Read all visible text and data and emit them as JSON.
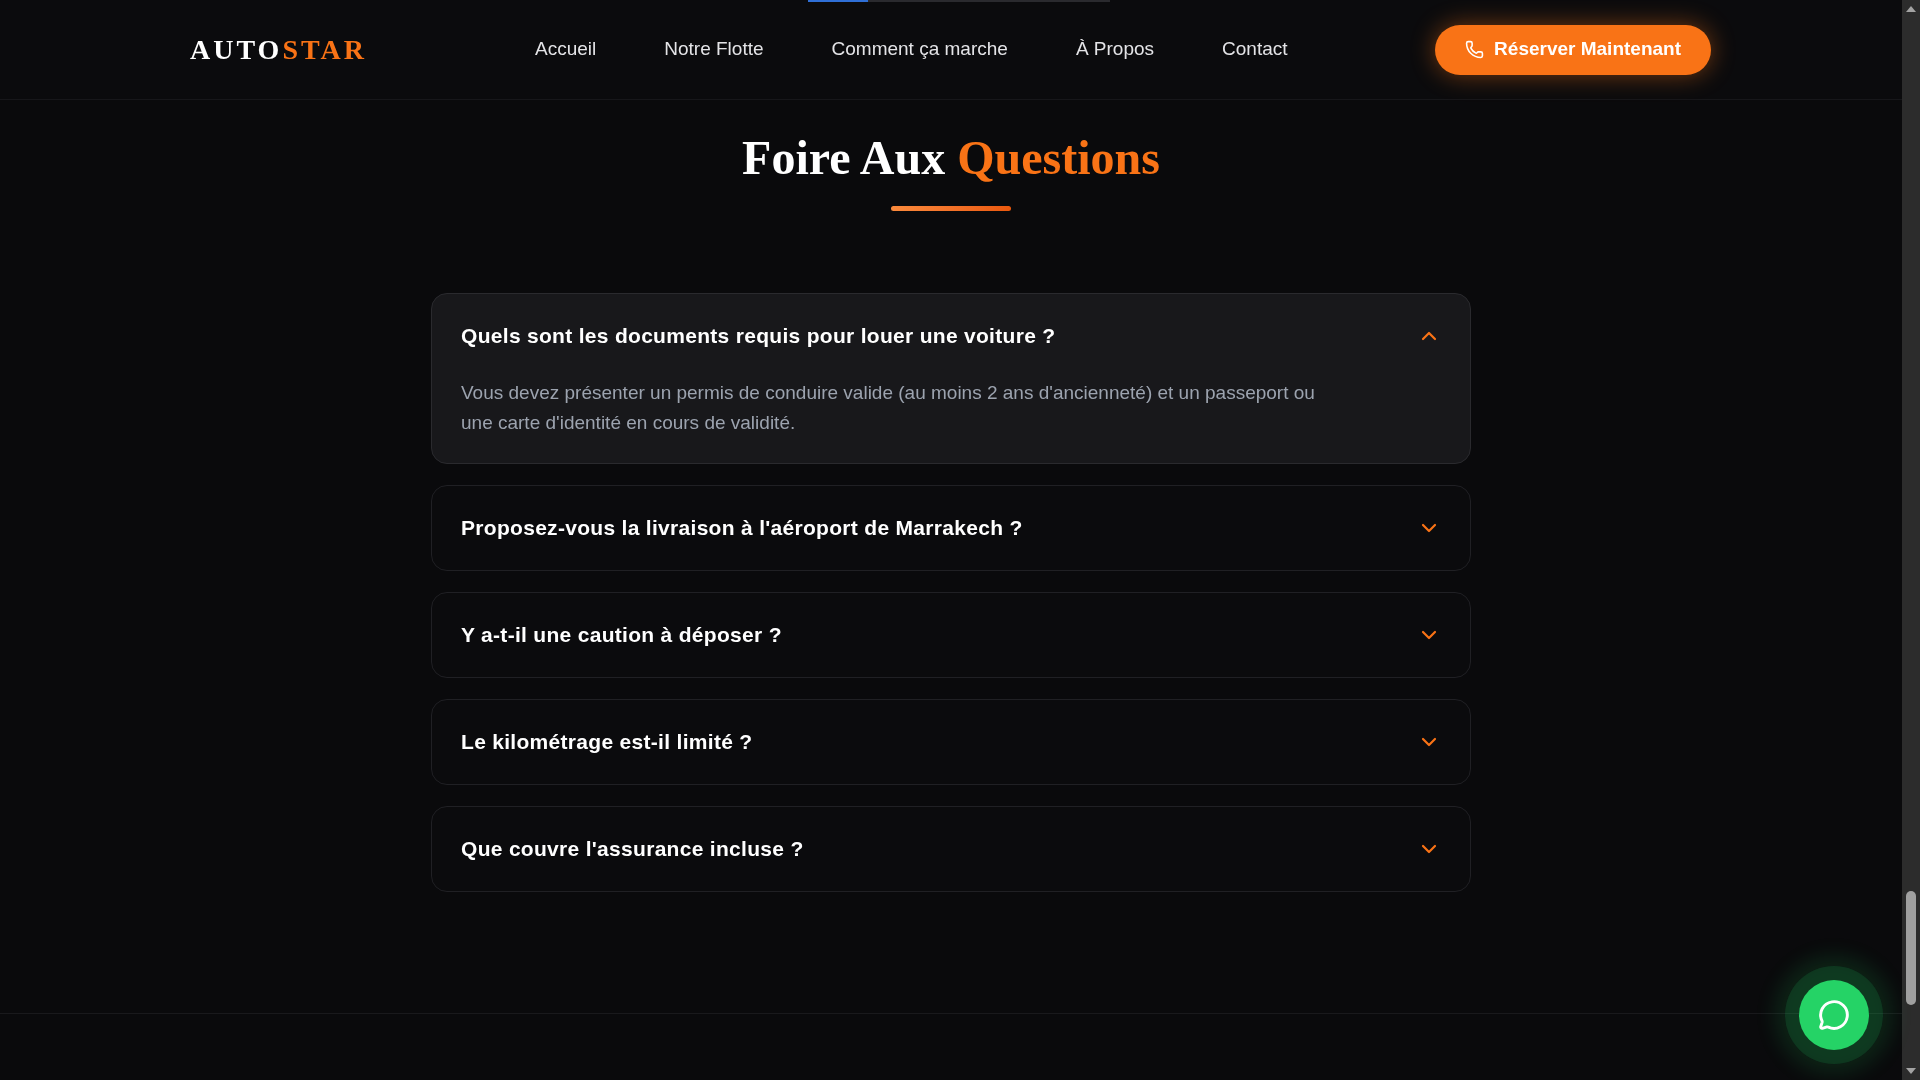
{
  "top_progress": {
    "level": 0.2
  },
  "header": {
    "logo": {
      "lead": "AUTO",
      "accent": "STAR"
    },
    "nav": [
      {
        "label": "Accueil"
      },
      {
        "label": "Notre Flotte"
      },
      {
        "label": "Comment ça marche"
      },
      {
        "label": "À Propos"
      },
      {
        "label": "Contact"
      }
    ],
    "cta": {
      "label": "Réserver Maintenant"
    }
  },
  "faq": {
    "title": {
      "lead": "Foire Aux",
      "accent": "Questions"
    },
    "items": [
      {
        "question": "Quels sont les documents requis pour louer une voiture ?",
        "expanded": true,
        "answer": "Vous devez présenter un permis de conduire valide (au moins 2 ans d'ancienneté) et un passeport ou une carte d'identité en cours de validité."
      },
      {
        "question": "Proposez-vous la livraison à l'aéroport de Marrakech ?",
        "expanded": false
      },
      {
        "question": "Y a-t-il une caution à déposer ?",
        "expanded": false
      },
      {
        "question": "Le kilométrage est-il limité ?",
        "expanded": false
      },
      {
        "question": "Que couvre l'assurance incluse ?",
        "expanded": false
      }
    ]
  }
}
